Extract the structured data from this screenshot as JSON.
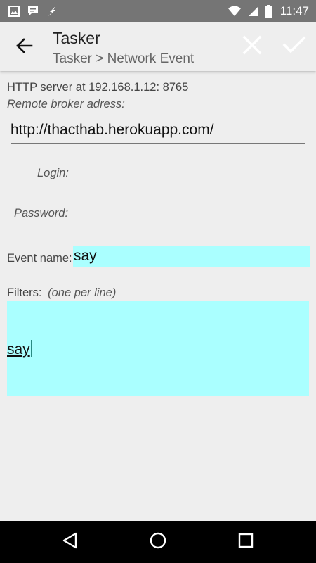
{
  "status_bar": {
    "time": "11:47",
    "icons": [
      "image-icon",
      "chat-icon",
      "flash-icon",
      "wifi-icon",
      "signal-icon",
      "battery-icon"
    ]
  },
  "action_bar": {
    "title": "Tasker",
    "subtitle": "Tasker > Network Event",
    "icons": [
      "back-arrow-icon",
      "close-icon",
      "check-icon"
    ]
  },
  "form": {
    "http_server_text": "HTTP server at 192.168.1.12: 8765",
    "broker_label": "Remote broker adress:",
    "broker_value": "http://thacthab.herokuapp.com/",
    "login_label": "Login:",
    "login_value": "",
    "password_label": "Password:",
    "password_value": "",
    "event_label": "Event name:",
    "event_value": "say",
    "filters_label": "Filters:",
    "filters_hint": "(one per line)",
    "filters_value": "say"
  },
  "nav_bar": {
    "icons": [
      "back-triangle-icon",
      "home-circle-icon",
      "recents-square-icon"
    ]
  },
  "colors": {
    "status_bar": "#757575",
    "background": "#eeeeee",
    "highlight_field": "#aaffff",
    "nav_bar": "#000000"
  }
}
